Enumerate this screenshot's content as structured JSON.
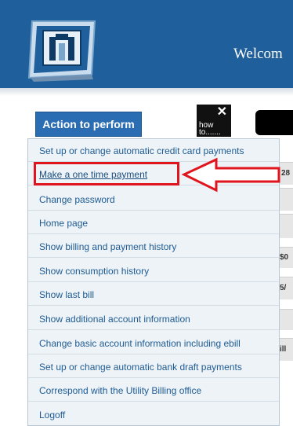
{
  "header": {
    "welcome_text": "Welcom",
    "colors": {
      "header_bg": "#1f5f9c",
      "accent_red": "#e0141c"
    }
  },
  "toolbar": {
    "action_label": "Action to perform",
    "howto_icon": "tools-icon",
    "howto_line1": "how",
    "howto_line2": "to......."
  },
  "menu": {
    "items": [
      {
        "label": "Set up or change automatic credit card payments"
      },
      {
        "label": "Make a one time payment",
        "highlighted": true
      },
      {
        "label": "Change password"
      },
      {
        "label": "Home page"
      },
      {
        "label": "Show billing and payment history"
      },
      {
        "label": "Show consumption history"
      },
      {
        "label": "Show last bill"
      },
      {
        "label": "Show additional account information"
      },
      {
        "label": "Change basic account information including ebill"
      },
      {
        "label": "Set up or change automatic bank draft payments"
      },
      {
        "label": "Correspond with the Utility Billing office"
      },
      {
        "label": "Logoff"
      }
    ]
  },
  "background_fragments": {
    "frag1": "28",
    "frag2": "$0",
    "frag3": "5/",
    "frag4": "ill"
  }
}
